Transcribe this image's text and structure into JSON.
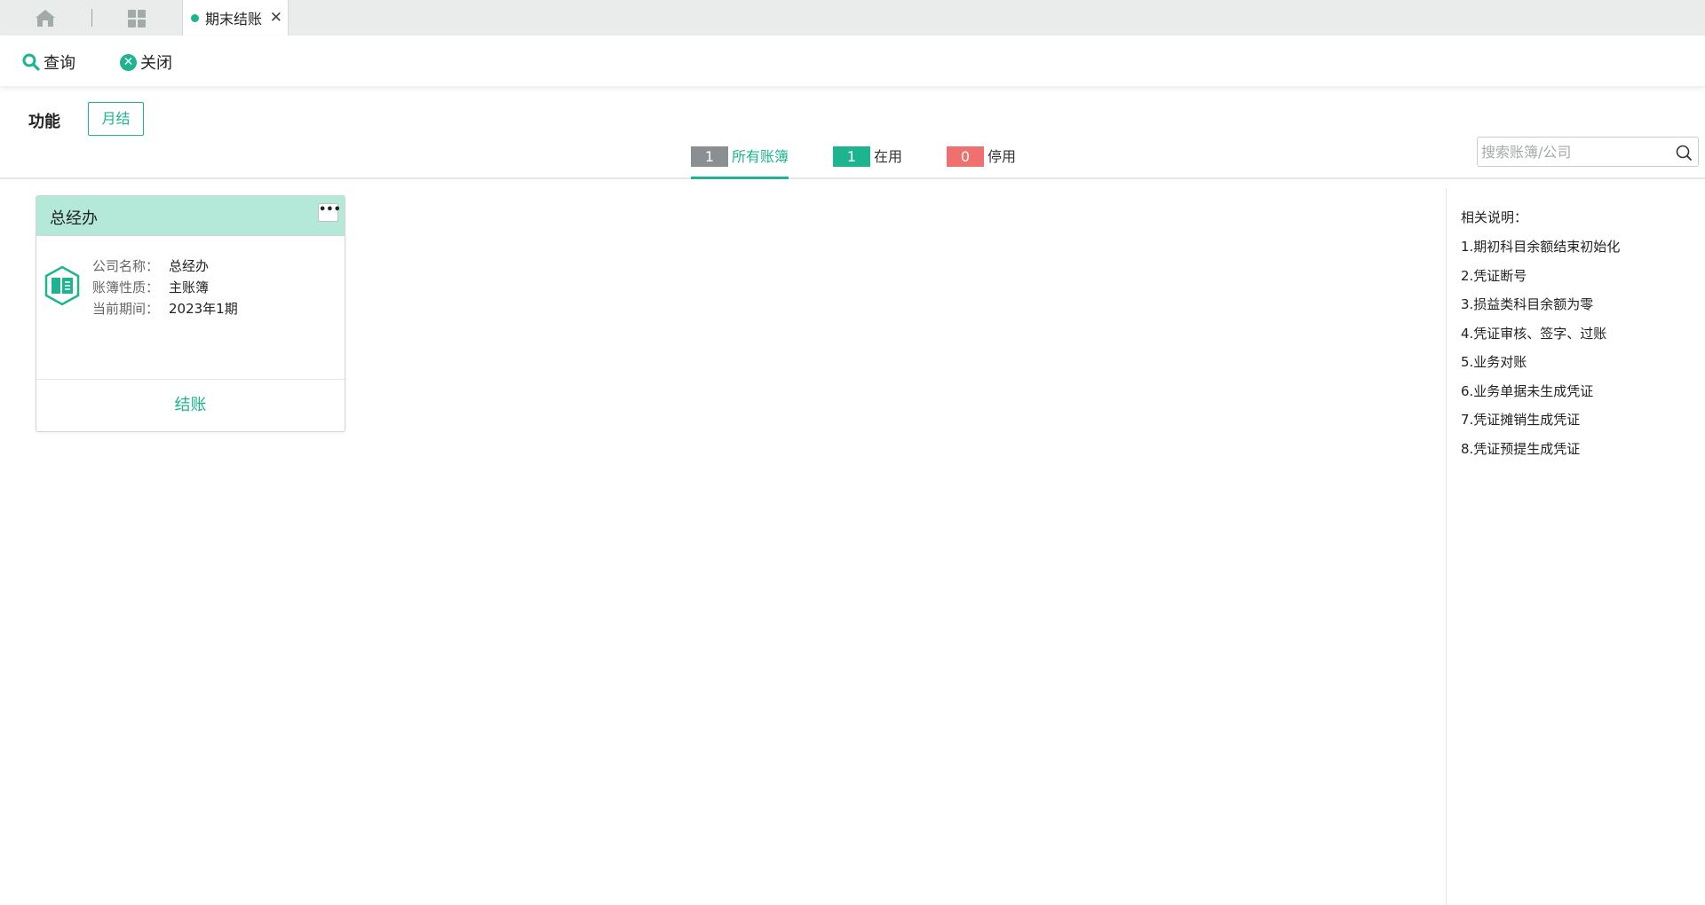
{
  "tabs": {
    "active_tab_label": "期末结账",
    "close_glyph": "✕"
  },
  "toolbar": {
    "query_label": "查询",
    "close_label": "关闭",
    "close_glyph": "✕"
  },
  "function": {
    "label": "功能",
    "monthly_label": "月结"
  },
  "filters": {
    "all": {
      "count": "1",
      "label": "所有账簿"
    },
    "active": {
      "count": "1",
      "label": "在用"
    },
    "stopped": {
      "count": "0",
      "label": "停用"
    }
  },
  "search": {
    "placeholder": "搜索账簿/公司",
    "value": ""
  },
  "card": {
    "title": "总经办",
    "more_glyph": "•••",
    "fields": [
      {
        "key": "公司名称：",
        "value": "总经办"
      },
      {
        "key": "账簿性质：",
        "value": "主账簿"
      },
      {
        "key": "当前期间：",
        "value": "2023年1期"
      }
    ],
    "action_label": "结账"
  },
  "notes": {
    "title": "相关说明：",
    "items": [
      "1.期初科目余额结束初始化",
      "2.凭证断号",
      "3.损益类科目余额为零",
      "4.凭证审核、签字、过账",
      "5.业务对账",
      "6.业务单据未生成凭证",
      "7.凭证摊销生成凭证",
      "8.凭证预提生成凭证"
    ]
  },
  "colors": {
    "accent": "#1db48f",
    "card_header": "#b4e8d9",
    "badge_all": "#8c8f92",
    "badge_stop": "#f07070",
    "tabbar_bg": "#e9eceb"
  },
  "icons": {
    "home": "home-icon",
    "apps": "apps-grid-icon",
    "query": "search-icon",
    "close": "close-circle-icon",
    "more": "more-icon",
    "ledger": "ledger-book-icon"
  }
}
